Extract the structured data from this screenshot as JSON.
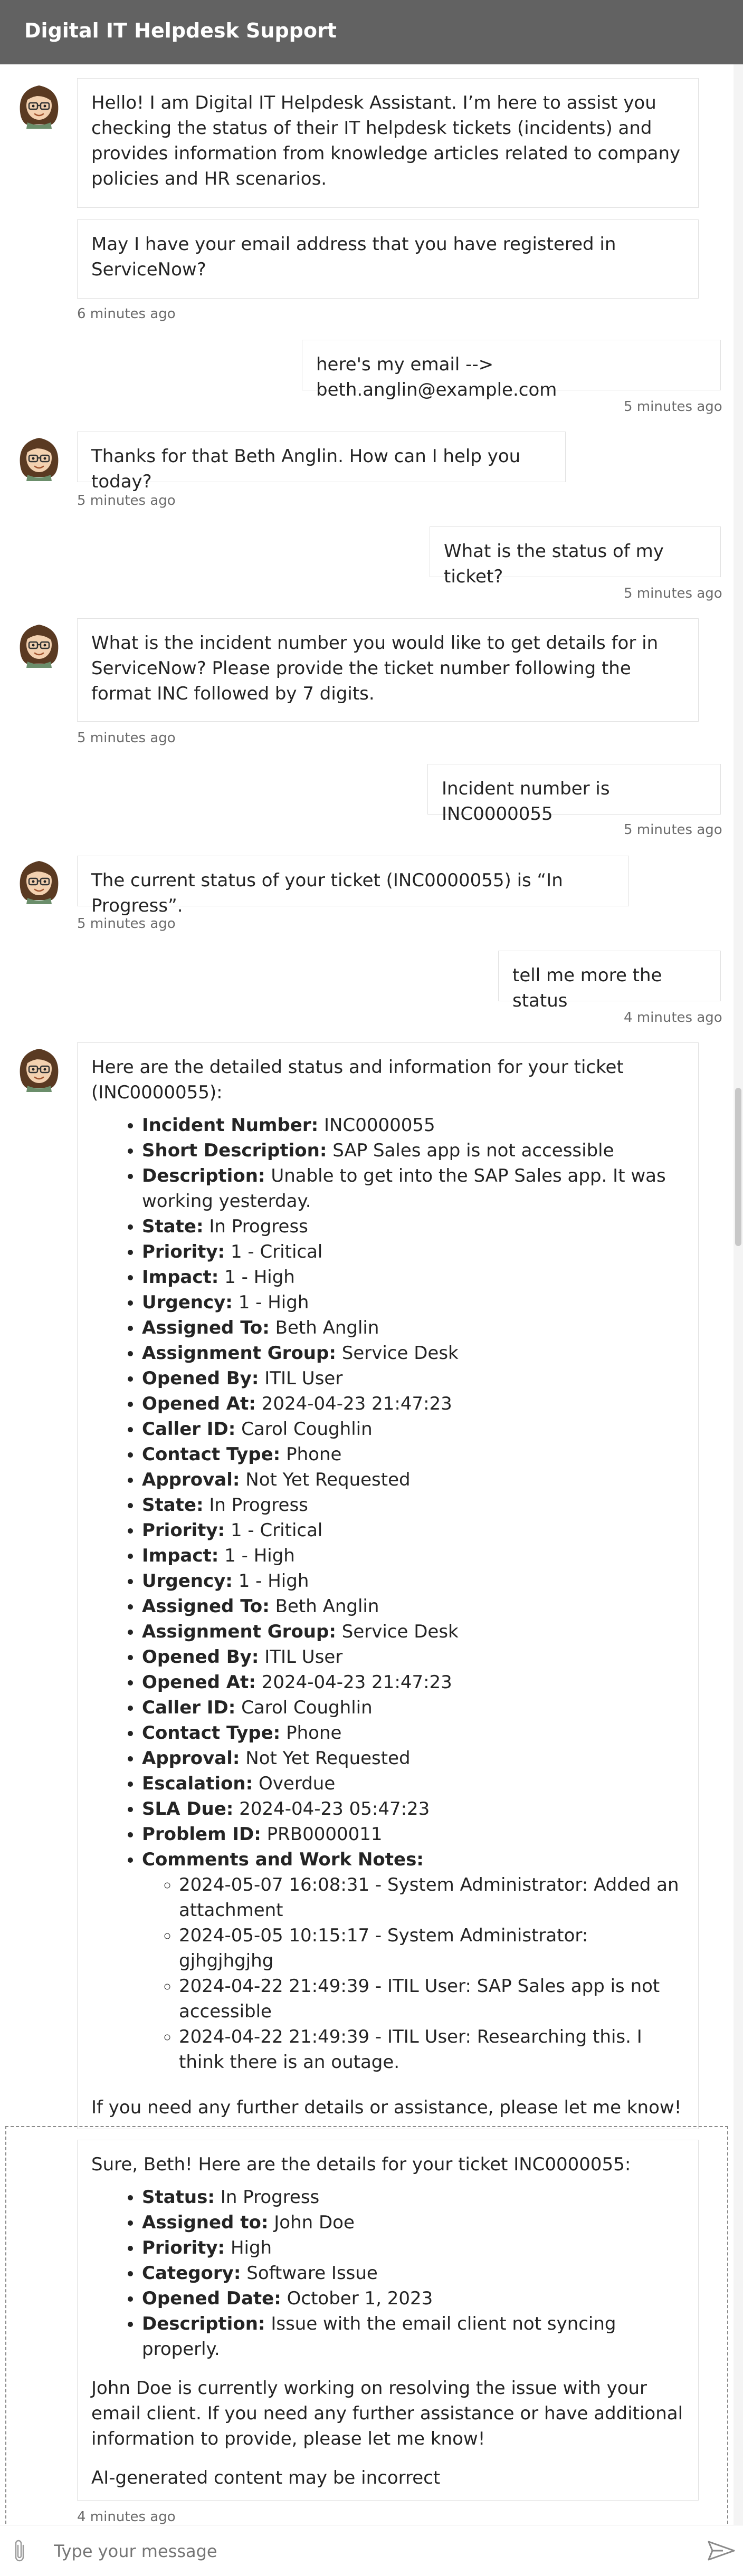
{
  "header": {
    "title": "Digital IT Helpdesk Support"
  },
  "messages": {
    "m1": {
      "text": "Hello! I am Digital IT Helpdesk Assistant. I’m here to assist you checking the status of their IT helpdesk tickets (incidents) and provides information from knowledge articles related to company policies and HR scenarios."
    },
    "m2": {
      "text": "May I have your email address that you have registered in ServiceNow?",
      "time": "6 minutes ago"
    },
    "u1": {
      "text": "here's my email --> beth.anglin@example.com",
      "time": "5 minutes ago"
    },
    "m3": {
      "text": "Thanks for that Beth Anglin. How can I help you today?",
      "time": "5 minutes ago"
    },
    "u2": {
      "text": "What is the status of my ticket?",
      "time": "5 minutes ago"
    },
    "m4": {
      "text": "What is the incident number you would like to get details for in ServiceNow? Please provide the ticket number following the format INC followed by 7 digits.",
      "time": "5 minutes ago"
    },
    "u3": {
      "text": "Incident number is INC0000055",
      "time": "5 minutes ago"
    },
    "m5": {
      "text": "The current status of your ticket (INC0000055) is “In Progress”.",
      "time": "5 minutes ago"
    },
    "u4": {
      "text": "tell me more the status",
      "time": "4 minutes ago"
    },
    "m6": {
      "intro": "Here are the detailed status and information for your ticket (INC0000055):",
      "items": [
        {
          "k": "Incident Number:",
          "v": " INC0000055"
        },
        {
          "k": "Short Description:",
          "v": " SAP Sales app is not accessible"
        },
        {
          "k": "Description:",
          "v": " Unable to get into the SAP Sales app. It was working yesterday."
        },
        {
          "k": "State:",
          "v": " In Progress"
        },
        {
          "k": "Priority:",
          "v": " 1 - Critical"
        },
        {
          "k": "Impact:",
          "v": " 1 - High"
        },
        {
          "k": "Urgency:",
          "v": " 1 - High"
        },
        {
          "k": "Assigned To:",
          "v": " Beth Anglin"
        },
        {
          "k": "Assignment Group:",
          "v": " Service Desk"
        },
        {
          "k": "Opened By:",
          "v": " ITIL User"
        },
        {
          "k": "Opened At:",
          "v": " 2024-04-23 21:47:23"
        },
        {
          "k": "Caller ID:",
          "v": " Carol Coughlin"
        },
        {
          "k": "Contact Type:",
          "v": " Phone"
        },
        {
          "k": "Approval:",
          "v": " Not Yet Requested"
        },
        {
          "k": "State:",
          "v": " In Progress"
        },
        {
          "k": "Priority:",
          "v": " 1 - Critical"
        },
        {
          "k": "Impact:",
          "v": " 1 - High"
        },
        {
          "k": "Urgency:",
          "v": " 1 - High"
        },
        {
          "k": "Assigned To:",
          "v": " Beth Anglin"
        },
        {
          "k": "Assignment Group:",
          "v": " Service Desk"
        },
        {
          "k": "Opened By:",
          "v": " ITIL User"
        },
        {
          "k": "Opened At:",
          "v": " 2024-04-23 21:47:23"
        },
        {
          "k": "Caller ID:",
          "v": " Carol Coughlin"
        },
        {
          "k": "Contact Type:",
          "v": " Phone"
        },
        {
          "k": "Approval:",
          "v": " Not Yet Requested"
        },
        {
          "k": "Escalation:",
          "v": " Overdue"
        },
        {
          "k": "SLA Due:",
          "v": " 2024-04-23 05:47:23"
        },
        {
          "k": "Problem ID:",
          "v": " PRB0000011"
        },
        {
          "k": "Comments and Work Notes:",
          "v": ""
        }
      ],
      "notes": [
        "2024-05-07 16:08:31 - System Administrator: Added an attachment",
        "2024-05-05 10:15:17 - System Administrator: gjhgjhgjhg",
        "2024-04-22 21:49:39 - ITIL User: SAP Sales app is not accessible",
        "2024-04-22 21:49:39 - ITIL User: Researching this. I think there is an outage."
      ],
      "outro": "If you need any further details or assistance, please let me know!"
    },
    "m7": {
      "intro": "Sure, Beth! Here are the details for your ticket INC0000055:",
      "items": [
        {
          "k": "Status:",
          "v": " In Progress"
        },
        {
          "k": "Assigned to:",
          "v": " John Doe"
        },
        {
          "k": "Priority:",
          "v": " High"
        },
        {
          "k": "Category:",
          "v": " Software Issue"
        },
        {
          "k": "Opened Date:",
          "v": " October 1, 2023"
        },
        {
          "k": "Description:",
          "v": " Issue with the email client not syncing properly."
        }
      ],
      "outro": "John Doe is currently working on resolving the issue with your email client. If you need any further assistance or have additional information to provide, please let me know!",
      "disclaimer": "AI-generated content may be incorrect",
      "time": "4 minutes ago"
    }
  },
  "composer": {
    "placeholder": "Type your message"
  }
}
